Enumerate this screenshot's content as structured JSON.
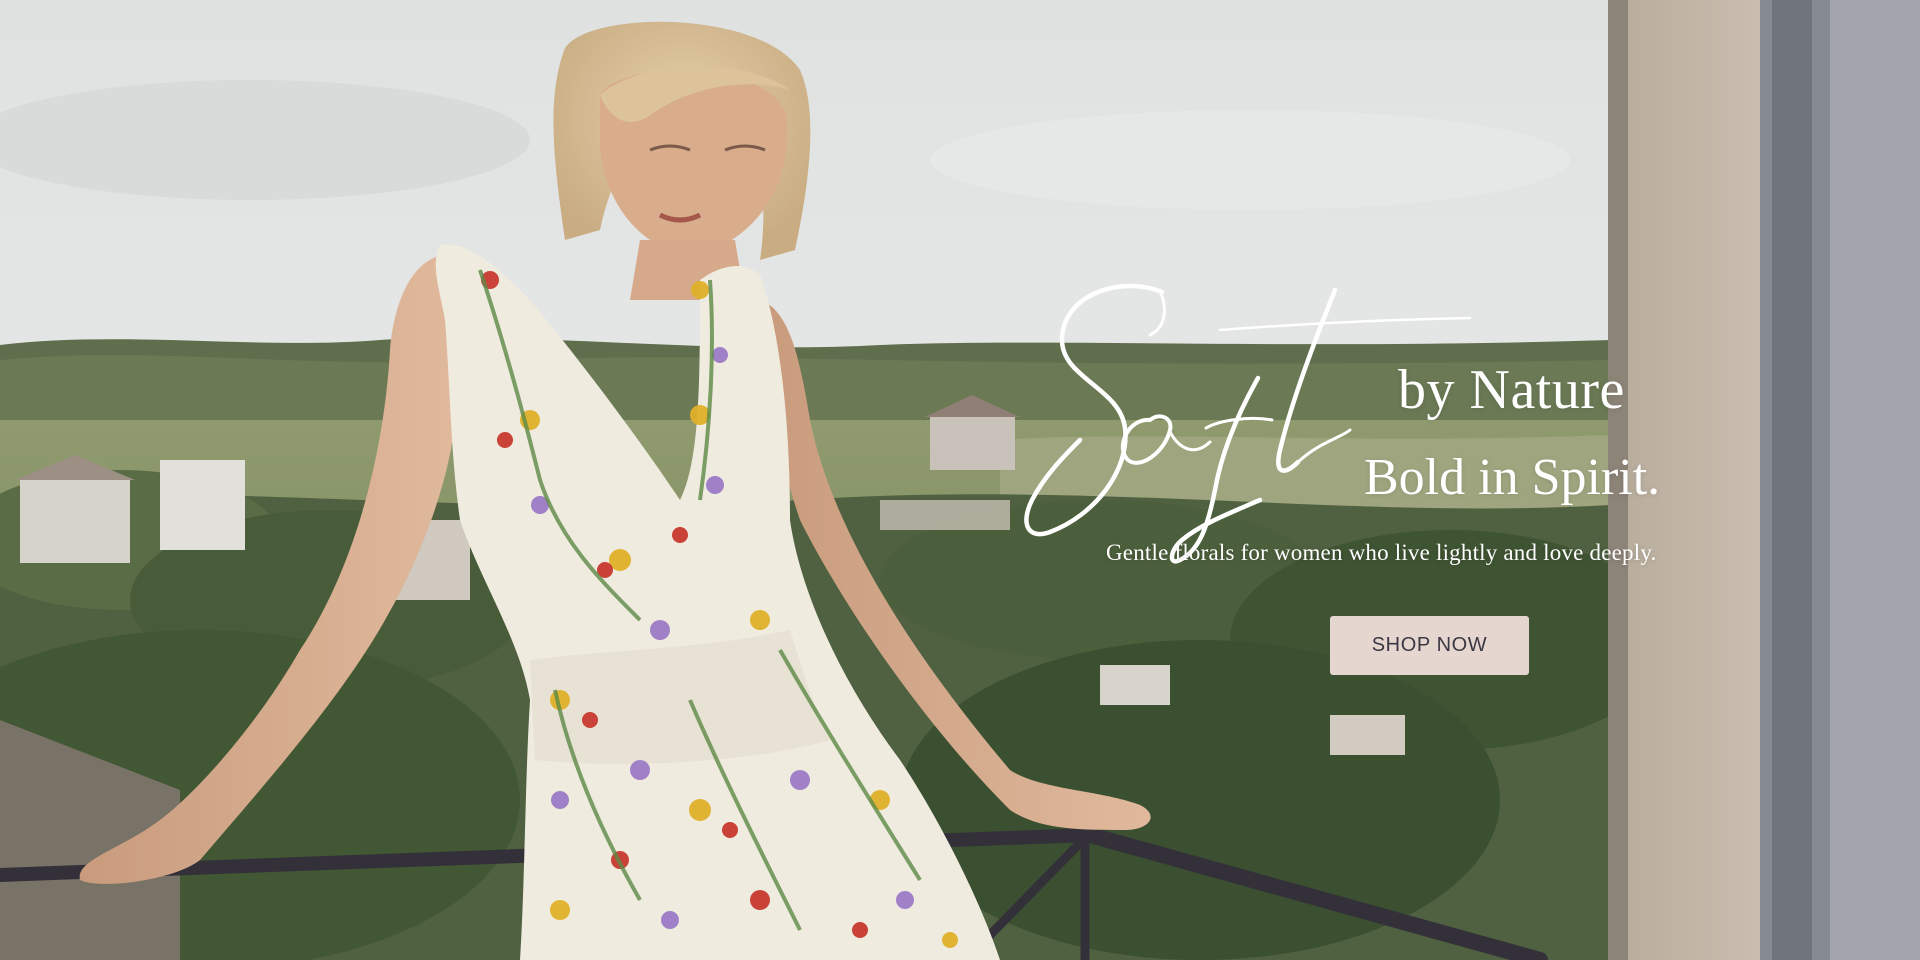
{
  "hero": {
    "script_word": "Soft",
    "line_1": "by Nature",
    "line_2": "Bold in Spirit.",
    "subtitle": "Gentle florals for women who live lightly and love deeply.",
    "cta_label": "SHOP NOW"
  },
  "colors": {
    "text": "#ffffff",
    "cta_background": "#e6d6d0",
    "cta_text": "#3a3842"
  }
}
